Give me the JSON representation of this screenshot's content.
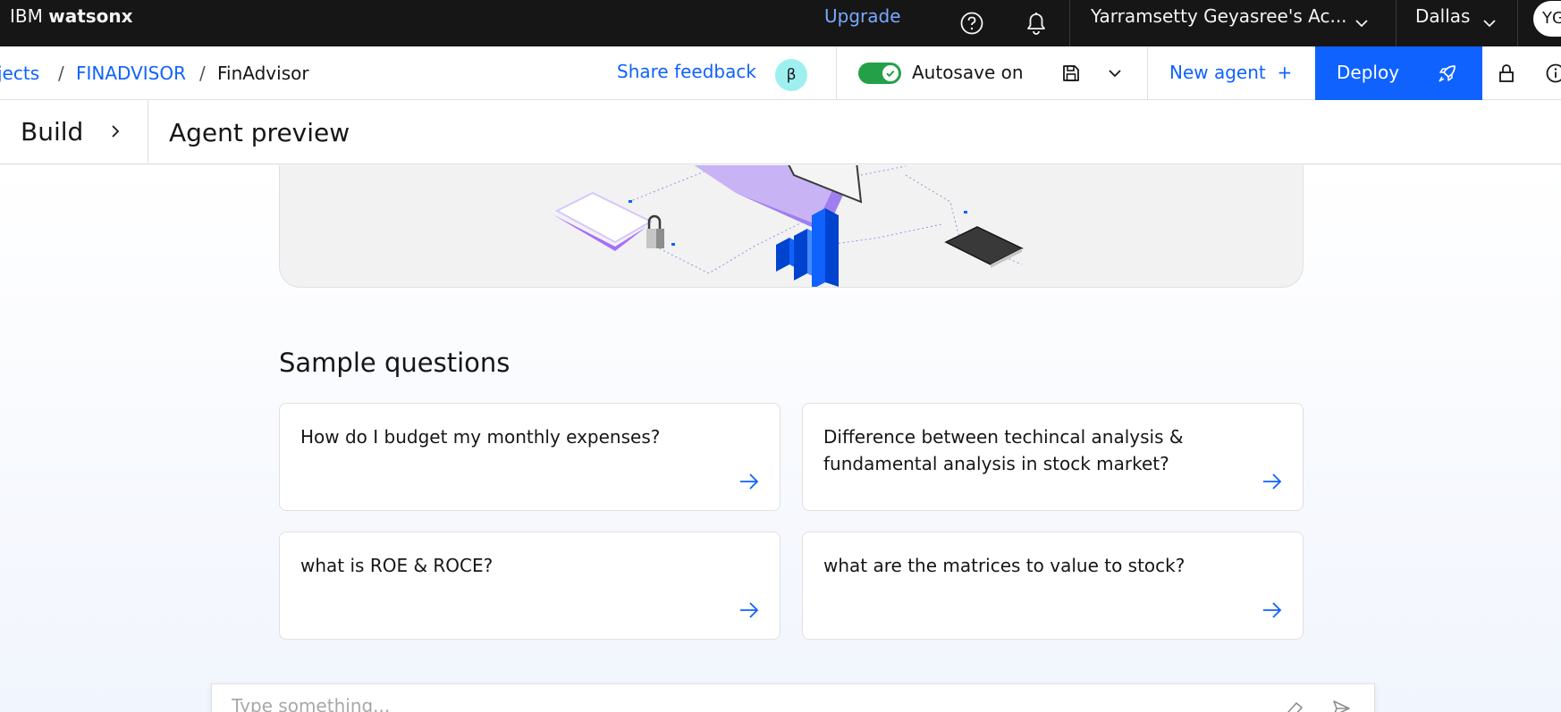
{
  "topbar": {
    "brand_prefix": "IBM",
    "brand_name": "watsonx",
    "upgrade": "Upgrade",
    "account": "Yarramsetty Geyasree's Ac...",
    "region": "Dallas",
    "avatar_initials": "YG"
  },
  "toolbar": {
    "breadcrumbs": [
      "jects",
      "FINADVISOR",
      "FinAdvisor"
    ],
    "breadcrumb_sep": "/",
    "share_feedback": "Share feedback",
    "beta_badge": "β",
    "autosave": "Autosave on",
    "autosave_on": true,
    "new_agent": "New agent",
    "new_agent_plus": "+",
    "deploy": "Deploy"
  },
  "subbar": {
    "build": "Build",
    "title": "Agent preview"
  },
  "main": {
    "sample_heading": "Sample questions",
    "questions": [
      "How do I budget my monthly expenses?",
      "Difference between techincal analysis & fundamental analysis in stock market?",
      "what is ROE & ROCE?",
      "what are the matrices to value to stock?"
    ],
    "input_placeholder": "Type something..."
  },
  "colors": {
    "accent": "#0f62fe",
    "topbar": "#161616",
    "toggle_on": "#24a148",
    "beta_badge": "#9ef0f0",
    "upgrade_link": "#78a9ff"
  }
}
